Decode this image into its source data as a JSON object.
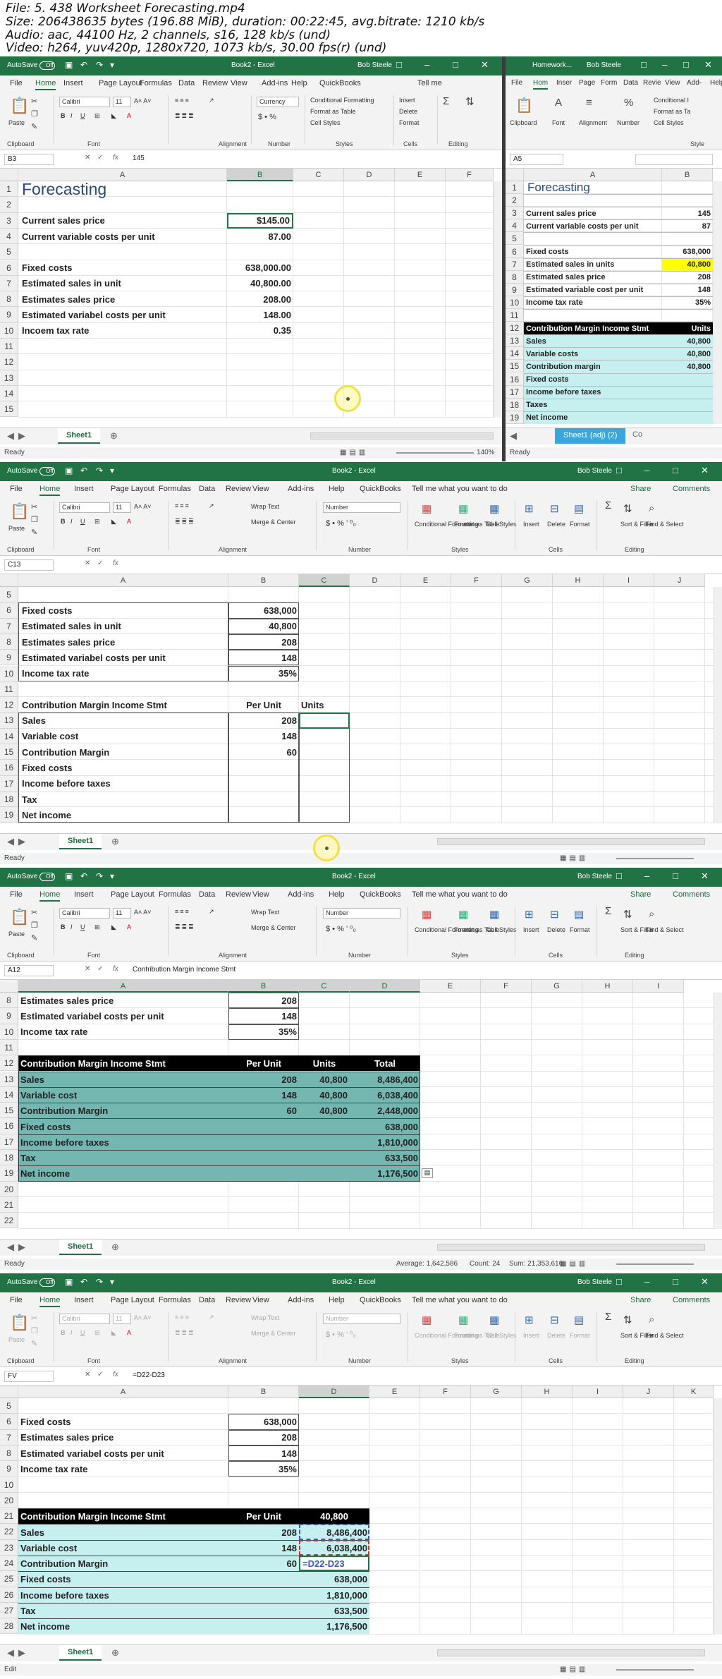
{
  "header": {
    "file": "File: 5. 438 Worksheet Forecasting.mp4",
    "size": "Size: 206438635 bytes (196.88 MiB), duration: 00:22:45, avg.bitrate: 1210 kb/s",
    "audio": "Audio: aac, 44100 Hz, 2 channels, s16, 128 kb/s (und)",
    "video": "Video: h264, yuv420p, 1280x720, 1073 kb/s, 30.00 fps(r) (und)"
  },
  "common": {
    "autosave": "AutoSave",
    "off": "Off",
    "book_title": "Book2 - Excel",
    "user": "Bob Steele",
    "menu": [
      "File",
      "Home",
      "Insert",
      "Page Layout",
      "Formulas",
      "Data",
      "Review",
      "View",
      "Add-ins",
      "Help",
      "QuickBooks",
      "Tell me what you want to do"
    ],
    "share": "Share",
    "comments": "Comments",
    "font": "Calibri",
    "size": "11",
    "numfmt": "Number",
    "currency": "Currency",
    "wrap": "Wrap Text",
    "merge": "Merge & Center",
    "cond": "Conditional Formatting",
    "fmt_table": "Format as Table",
    "cell_styles": "Cell Styles",
    "insert": "Insert",
    "delete": "Delete",
    "format": "Format",
    "sort": "Sort & Filter",
    "find": "Find & Select",
    "clipboard": "Clipboard",
    "fontg": "Font",
    "alignment": "Alignment",
    "number": "Number",
    "styles": "Styles",
    "cells": "Cells",
    "editing": "Editing",
    "paste": "Paste",
    "tell": "Tell me",
    "sheet1": "Sheet1",
    "ready": "Ready",
    "edit": "Edit",
    "zoom": "140%",
    "fx": "fx"
  },
  "frame1": {
    "name_box": "B3",
    "formula": "145",
    "cols": [
      "A",
      "B",
      "C",
      "D",
      "E",
      "F"
    ],
    "rows": [
      "1",
      "2",
      "3",
      "4",
      "5",
      "6",
      "7",
      "8",
      "9",
      "10",
      "11",
      "12",
      "13",
      "14",
      "15"
    ],
    "title": "Forecasting",
    "labels": {
      "r3": "Current sales price",
      "r4": "Current variable costs per unit",
      "r6": "Fixed costs",
      "r7": "Estimated sales in unit",
      "r8": "Estimates sales price",
      "r9": "Estimated variabel costs per unit",
      "r10": "Incoem tax rate"
    },
    "values": {
      "r3": "$145.00",
      "r4": "87.00",
      "r6": "638,000.00",
      "r7": "40,800.00",
      "r8": "208.00",
      "r9": "148.00",
      "r10": "0.35"
    },
    "side": {
      "title": "Homework...",
      "user": "Bob Steele",
      "name_box": "A5",
      "menu": [
        "File",
        "Hom",
        "Inser",
        "Page",
        "Form",
        "Data",
        "Revie",
        "View",
        "Add-",
        "Help"
      ],
      "cols": [
        "A",
        "B"
      ],
      "rows": [
        "1",
        "2",
        "3",
        "4",
        "5",
        "6",
        "7",
        "8",
        "9",
        "10",
        "11",
        "12",
        "13",
        "14",
        "15",
        "16",
        "17",
        "18",
        "19"
      ],
      "title_cell": "Forecasting",
      "labels": [
        "",
        "",
        "Current sales price",
        "Current variable costs per unit",
        "",
        "Fixed costs",
        "Estimated sales in units",
        "Estimated sales price",
        "Estimated variable cost per unit",
        "Income tax rate",
        "",
        "Contribution Margin Income Stmt",
        "Sales",
        "Variable costs",
        "Contribution margin",
        "Fixed costs",
        "Income before taxes",
        "Taxes",
        "Net income"
      ],
      "values": [
        "",
        "",
        "145",
        "87",
        "",
        "638,000",
        "40,800",
        "208",
        "148",
        "35%",
        "",
        "Units",
        "40,800",
        "40,800",
        "40,800",
        "",
        "",
        "",
        ""
      ],
      "tab": "Sheet1 (adj) (2)",
      "tab2": "Co",
      "cond": "Conditional I",
      "fmt_table": "Format as Ta",
      "cell_styles": "Cell Styles",
      "style": "Style"
    }
  },
  "frame2": {
    "name_box": "C13",
    "formula": "",
    "cols": [
      "A",
      "B",
      "C",
      "D",
      "E",
      "F",
      "G",
      "H",
      "I",
      "J"
    ],
    "rows": [
      "5",
      "6",
      "7",
      "8",
      "9",
      "10",
      "11",
      "12",
      "13",
      "14",
      "15",
      "16",
      "17",
      "18",
      "19"
    ],
    "labels": [
      "",
      "Fixed costs",
      "Estimated sales in unit",
      "Estimates sales price",
      "Estimated variabel costs per unit",
      "Income tax rate",
      "",
      "Contribution Margin Income Stmt",
      "Sales",
      "Variable cost",
      "Contribution Margin",
      "Fixed costs",
      "",
      "Income before taxes",
      "Tax",
      "Net income"
    ],
    "b": [
      "",
      "638,000",
      "40,800",
      "208",
      "148",
      "35%",
      "",
      "Per Unit",
      "208",
      "148",
      "60",
      "",
      "",
      "",
      "",
      ""
    ],
    "c12": "Units"
  },
  "frame3": {
    "name_box": "A12",
    "formula": "Contribution Margin Income Stmt",
    "cols": [
      "A",
      "B",
      "C",
      "D",
      "E",
      "F",
      "G",
      "H",
      "I"
    ],
    "rows": [
      "8",
      "9",
      "10",
      "11",
      "12",
      "13",
      "14",
      "15",
      "16",
      "17",
      "18",
      "19",
      "20",
      "21",
      "22"
    ],
    "labels": [
      "Estimates sales price",
      "Estimated variabel costs per unit",
      "Income tax rate",
      "",
      "Contribution Margin Income Stmt",
      "Sales",
      "Variable cost",
      "Contribution Margin",
      "Fixed costs",
      "Income before taxes",
      "Tax",
      "Net income",
      "",
      "",
      ""
    ],
    "b": [
      "208",
      "148",
      "35%",
      "",
      "Per Unit",
      "208",
      "148",
      "60",
      "",
      "",
      "",
      "",
      "",
      "",
      ""
    ],
    "c": [
      "",
      "",
      "",
      "",
      "Units",
      "40,800",
      "40,800",
      "40,800",
      "",
      "",
      "",
      "",
      "",
      "",
      ""
    ],
    "d": [
      "",
      "",
      "",
      "",
      "Total",
      "8,486,400",
      "6,038,400",
      "2,448,000",
      "638,000",
      "1,810,000",
      "633,500",
      "1,176,500",
      "",
      "",
      ""
    ],
    "status": {
      "avg": "Average: 1,642,586",
      "count": "Count: 24",
      "sum": "Sum: 21,353,616"
    }
  },
  "frame4": {
    "name_box": "FV",
    "formula": "=D22-D23",
    "cols": [
      "A",
      "B",
      "D",
      "E",
      "F",
      "G",
      "H",
      "I",
      "J",
      "K"
    ],
    "rows": [
      "5",
      "6",
      "7",
      "8",
      "9",
      "10",
      "20",
      "21",
      "22",
      "23",
      "24",
      "25",
      "26",
      "27",
      "28"
    ],
    "labels": [
      "",
      "Fixed costs",
      "Estimates sales price",
      "Estimated variabel costs per unit",
      "Income tax rate",
      "",
      "",
      "Contribution Margin Income Stmt",
      "Sales",
      "Variable cost",
      "Contribution Margin",
      "Fixed costs",
      "Income before taxes",
      "Tax",
      "Net income"
    ],
    "b": [
      "",
      "638,000",
      "208",
      "148",
      "35%",
      "",
      "",
      "Per Unit",
      "208",
      "148",
      "60",
      "",
      "",
      "",
      ""
    ],
    "d": [
      "",
      "",
      "",
      "",
      "",
      "",
      "",
      "40,800",
      "8,486,400",
      "6,038,400",
      "=D22-D23",
      "638,000",
      "1,810,000",
      "633,500",
      "1,176,500"
    ]
  },
  "colors": {
    "excel_green": "#217346",
    "teal_fill": "#74b6b0",
    "light_teal": "#c6efef",
    "yellow": "#ffff00",
    "black_hdr": "#000000"
  }
}
